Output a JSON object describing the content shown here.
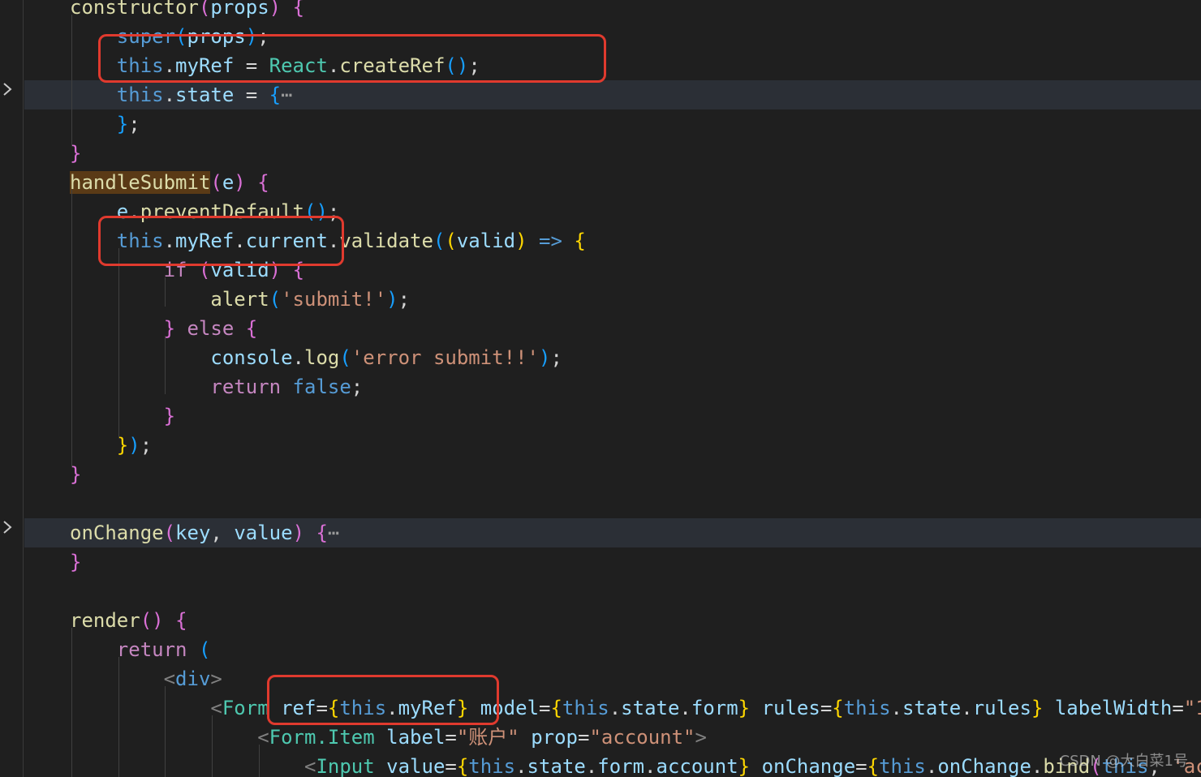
{
  "gutter": {
    "fold_icon": "chevron-right-icon"
  },
  "lines": [
    [
      {
        "t": "constructor",
        "c": "f"
      },
      {
        "t": "(",
        "c": "b2"
      },
      {
        "t": "props",
        "c": "v"
      },
      {
        "t": ")",
        "c": "b2"
      },
      {
        "t": " ",
        "c": "p"
      },
      {
        "t": "{",
        "c": "b2"
      }
    ],
    [
      {
        "t": "    ",
        "c": "p"
      },
      {
        "t": "super",
        "c": "k"
      },
      {
        "t": "(",
        "c": "b3"
      },
      {
        "t": "props",
        "c": "v"
      },
      {
        "t": ")",
        "c": "b3"
      },
      {
        "t": ";",
        "c": "p"
      }
    ],
    [
      {
        "t": "    ",
        "c": "p"
      },
      {
        "t": "this",
        "c": "k"
      },
      {
        "t": ".",
        "c": "p"
      },
      {
        "t": "myRef",
        "c": "v"
      },
      {
        "t": " = ",
        "c": "p"
      },
      {
        "t": "React",
        "c": "c"
      },
      {
        "t": ".",
        "c": "p"
      },
      {
        "t": "createRef",
        "c": "f"
      },
      {
        "t": "()",
        "c": "b3"
      },
      {
        "t": ";",
        "c": "p"
      }
    ],
    [
      {
        "t": "    ",
        "c": "p"
      },
      {
        "t": "this",
        "c": "k"
      },
      {
        "t": ".",
        "c": "p"
      },
      {
        "t": "state",
        "c": "v"
      },
      {
        "t": " = ",
        "c": "p"
      },
      {
        "t": "{",
        "c": "b3"
      },
      {
        "t": "⋯",
        "c": "fold-ellipsis"
      }
    ],
    [
      {
        "t": "    ",
        "c": "p"
      },
      {
        "t": "}",
        "c": "b3"
      },
      {
        "t": ";",
        "c": "p"
      }
    ],
    [
      {
        "t": "}",
        "c": "b2"
      }
    ],
    [
      {
        "t": "handleSubmit",
        "c": "fhl"
      },
      {
        "t": "(",
        "c": "b2"
      },
      {
        "t": "e",
        "c": "v"
      },
      {
        "t": ")",
        "c": "b2"
      },
      {
        "t": " ",
        "c": "p"
      },
      {
        "t": "{",
        "c": "b2"
      }
    ],
    [
      {
        "t": "    ",
        "c": "p"
      },
      {
        "t": "e",
        "c": "v"
      },
      {
        "t": ".",
        "c": "p"
      },
      {
        "t": "preventDefault",
        "c": "f"
      },
      {
        "t": "()",
        "c": "b3"
      },
      {
        "t": ";",
        "c": "p"
      }
    ],
    [
      {
        "t": "    ",
        "c": "p"
      },
      {
        "t": "this",
        "c": "k"
      },
      {
        "t": ".",
        "c": "p"
      },
      {
        "t": "myRef",
        "c": "v"
      },
      {
        "t": ".",
        "c": "p"
      },
      {
        "t": "current",
        "c": "v"
      },
      {
        "t": ".",
        "c": "p"
      },
      {
        "t": "validate",
        "c": "f"
      },
      {
        "t": "(",
        "c": "b3"
      },
      {
        "t": "(",
        "c": "b1"
      },
      {
        "t": "valid",
        "c": "v"
      },
      {
        "t": ")",
        "c": "b1"
      },
      {
        "t": " ",
        "c": "p"
      },
      {
        "t": "=>",
        "c": "k"
      },
      {
        "t": " ",
        "c": "p"
      },
      {
        "t": "{",
        "c": "b1"
      }
    ],
    [
      {
        "t": "        ",
        "c": "p"
      },
      {
        "t": "if",
        "c": "ctl"
      },
      {
        "t": " ",
        "c": "p"
      },
      {
        "t": "(",
        "c": "b2"
      },
      {
        "t": "valid",
        "c": "v"
      },
      {
        "t": ")",
        "c": "b2"
      },
      {
        "t": " ",
        "c": "p"
      },
      {
        "t": "{",
        "c": "b2"
      }
    ],
    [
      {
        "t": "            ",
        "c": "p"
      },
      {
        "t": "alert",
        "c": "f"
      },
      {
        "t": "(",
        "c": "b3"
      },
      {
        "t": "'submit!'",
        "c": "s"
      },
      {
        "t": ")",
        "c": "b3"
      },
      {
        "t": ";",
        "c": "p"
      }
    ],
    [
      {
        "t": "        ",
        "c": "p"
      },
      {
        "t": "}",
        "c": "b2"
      },
      {
        "t": " ",
        "c": "p"
      },
      {
        "t": "else",
        "c": "ctl"
      },
      {
        "t": " ",
        "c": "p"
      },
      {
        "t": "{",
        "c": "b2"
      }
    ],
    [
      {
        "t": "            ",
        "c": "p"
      },
      {
        "t": "console",
        "c": "v"
      },
      {
        "t": ".",
        "c": "p"
      },
      {
        "t": "log",
        "c": "f"
      },
      {
        "t": "(",
        "c": "b3"
      },
      {
        "t": "'error submit!!'",
        "c": "s"
      },
      {
        "t": ")",
        "c": "b3"
      },
      {
        "t": ";",
        "c": "p"
      }
    ],
    [
      {
        "t": "            ",
        "c": "p"
      },
      {
        "t": "return",
        "c": "ctl"
      },
      {
        "t": " ",
        "c": "p"
      },
      {
        "t": "false",
        "c": "k"
      },
      {
        "t": ";",
        "c": "p"
      }
    ],
    [
      {
        "t": "        ",
        "c": "p"
      },
      {
        "t": "}",
        "c": "b2"
      }
    ],
    [
      {
        "t": "    ",
        "c": "p"
      },
      {
        "t": "}",
        "c": "b1"
      },
      {
        "t": ")",
        "c": "b3"
      },
      {
        "t": ";",
        "c": "p"
      }
    ],
    [
      {
        "t": "}",
        "c": "b2"
      }
    ],
    [],
    [
      {
        "t": "onChange",
        "c": "f"
      },
      {
        "t": "(",
        "c": "b2"
      },
      {
        "t": "key",
        "c": "v"
      },
      {
        "t": ", ",
        "c": "p"
      },
      {
        "t": "value",
        "c": "v"
      },
      {
        "t": ")",
        "c": "b2"
      },
      {
        "t": " ",
        "c": "p"
      },
      {
        "t": "{",
        "c": "b2"
      },
      {
        "t": "⋯",
        "c": "fold-ellipsis"
      }
    ],
    [
      {
        "t": "}",
        "c": "b2"
      }
    ],
    [],
    [
      {
        "t": "render",
        "c": "f"
      },
      {
        "t": "()",
        "c": "b2"
      },
      {
        "t": " ",
        "c": "p"
      },
      {
        "t": "{",
        "c": "b2"
      }
    ],
    [
      {
        "t": "    ",
        "c": "p"
      },
      {
        "t": "return",
        "c": "ctl"
      },
      {
        "t": " ",
        "c": "p"
      },
      {
        "t": "(",
        "c": "b3"
      }
    ],
    [
      {
        "t": "        ",
        "c": "p"
      },
      {
        "t": "<",
        "c": "tag"
      },
      {
        "t": "div",
        "c": "k"
      },
      {
        "t": ">",
        "c": "tag"
      }
    ],
    [
      {
        "t": "            ",
        "c": "p"
      },
      {
        "t": "<",
        "c": "tag"
      },
      {
        "t": "Form",
        "c": "tn"
      },
      {
        "t": " ",
        "c": "p"
      },
      {
        "t": "ref",
        "c": "at"
      },
      {
        "t": "=",
        "c": "p"
      },
      {
        "t": "{",
        "c": "b1"
      },
      {
        "t": "this",
        "c": "k"
      },
      {
        "t": ".",
        "c": "p"
      },
      {
        "t": "myRef",
        "c": "v"
      },
      {
        "t": "}",
        "c": "b1"
      },
      {
        "t": " ",
        "c": "p"
      },
      {
        "t": "model",
        "c": "at"
      },
      {
        "t": "=",
        "c": "p"
      },
      {
        "t": "{",
        "c": "b1"
      },
      {
        "t": "this",
        "c": "k"
      },
      {
        "t": ".",
        "c": "p"
      },
      {
        "t": "state",
        "c": "v"
      },
      {
        "t": ".",
        "c": "p"
      },
      {
        "t": "form",
        "c": "v"
      },
      {
        "t": "}",
        "c": "b1"
      },
      {
        "t": " ",
        "c": "p"
      },
      {
        "t": "rules",
        "c": "at"
      },
      {
        "t": "=",
        "c": "p"
      },
      {
        "t": "{",
        "c": "b1"
      },
      {
        "t": "this",
        "c": "k"
      },
      {
        "t": ".",
        "c": "p"
      },
      {
        "t": "state",
        "c": "v"
      },
      {
        "t": ".",
        "c": "p"
      },
      {
        "t": "rules",
        "c": "v"
      },
      {
        "t": "}",
        "c": "b1"
      },
      {
        "t": " ",
        "c": "p"
      },
      {
        "t": "labelWidth",
        "c": "at"
      },
      {
        "t": "=",
        "c": "p"
      },
      {
        "t": "\"1",
        "c": "s"
      }
    ],
    [
      {
        "t": "                ",
        "c": "p"
      },
      {
        "t": "<",
        "c": "tag"
      },
      {
        "t": "Form.Item",
        "c": "tn"
      },
      {
        "t": " ",
        "c": "p"
      },
      {
        "t": "label",
        "c": "at"
      },
      {
        "t": "=",
        "c": "p"
      },
      {
        "t": "\"账户\"",
        "c": "s"
      },
      {
        "t": " ",
        "c": "p"
      },
      {
        "t": "prop",
        "c": "at"
      },
      {
        "t": "=",
        "c": "p"
      },
      {
        "t": "\"account\"",
        "c": "s"
      },
      {
        "t": ">",
        "c": "tag"
      }
    ],
    [
      {
        "t": "                    ",
        "c": "p"
      },
      {
        "t": "<",
        "c": "tag"
      },
      {
        "t": "Input",
        "c": "tn"
      },
      {
        "t": " ",
        "c": "p"
      },
      {
        "t": "value",
        "c": "at"
      },
      {
        "t": "=",
        "c": "p"
      },
      {
        "t": "{",
        "c": "b1"
      },
      {
        "t": "this",
        "c": "k"
      },
      {
        "t": ".",
        "c": "p"
      },
      {
        "t": "state",
        "c": "v"
      },
      {
        "t": ".",
        "c": "p"
      },
      {
        "t": "form",
        "c": "v"
      },
      {
        "t": ".",
        "c": "p"
      },
      {
        "t": "account",
        "c": "v"
      },
      {
        "t": "}",
        "c": "b1"
      },
      {
        "t": " ",
        "c": "p"
      },
      {
        "t": "onChange",
        "c": "at"
      },
      {
        "t": "=",
        "c": "p"
      },
      {
        "t": "{",
        "c": "b1"
      },
      {
        "t": "this",
        "c": "k"
      },
      {
        "t": ".",
        "c": "p"
      },
      {
        "t": "onChange",
        "c": "v"
      },
      {
        "t": ".",
        "c": "p"
      },
      {
        "t": "bind",
        "c": "f"
      },
      {
        "t": "(",
        "c": "b2"
      },
      {
        "t": "this",
        "c": "k"
      },
      {
        "t": ", ",
        "c": "p"
      },
      {
        "t": "'ac",
        "c": "s"
      }
    ]
  ],
  "watermark": "CSDN @大白菜1号"
}
